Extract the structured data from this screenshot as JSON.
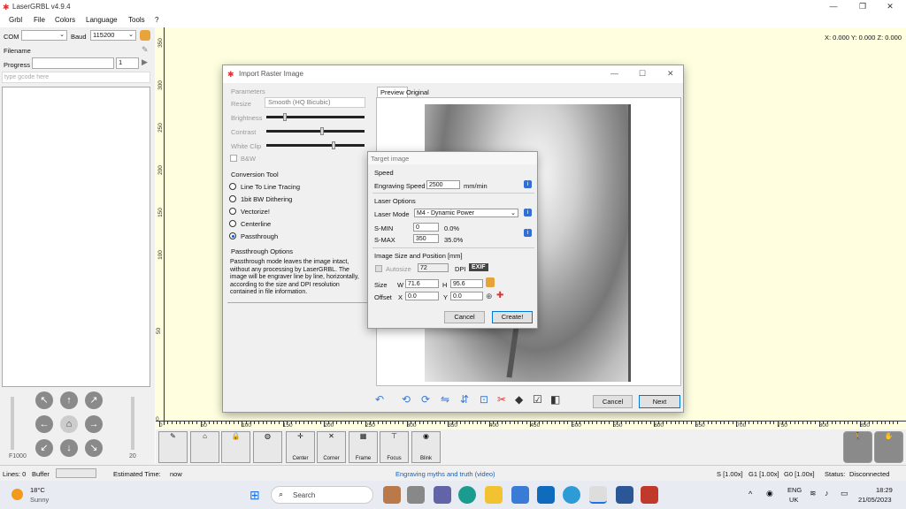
{
  "window": {
    "title": "LaserGRBL v4.9.4"
  },
  "menu": [
    "Grbl",
    "File",
    "Colors",
    "Language",
    "Tools",
    "?"
  ],
  "left": {
    "com_label": "COM",
    "com_value": "",
    "baud_label": "Baud",
    "baud_value": "115200",
    "filename_label": "Filename",
    "progress_label": "Progress",
    "progress_value": "1",
    "gcode_placeholder": "type gcode here",
    "feed": "F1000",
    "step": "20"
  },
  "coords": "X: 0.000 Y: 0.000 Z: 0.000",
  "vruler": [
    "350",
    "300",
    "250",
    "200",
    "150",
    "100",
    "50",
    "0"
  ],
  "hruler": [
    "0",
    "50",
    "100",
    "150",
    "200",
    "250",
    "300",
    "350",
    "400",
    "450",
    "500",
    "550",
    "600",
    "650",
    "700",
    "750",
    "800",
    "850"
  ],
  "toolbar": [
    "Center",
    "Corner",
    "Frame",
    "Focus",
    "Blink"
  ],
  "status": {
    "lines": "Lines: 0",
    "buffer": "Buffer",
    "est": "Estimated Time:",
    "est_val": "now",
    "link": "Engraving myths and truth (video)",
    "s": "S [1.00x]",
    "g1": "G1 [1.00x]",
    "g0": "G0 [1.00x]",
    "status": "Status:",
    "status_val": "Disconnected"
  },
  "dialog": {
    "title": "Import Raster Image",
    "params_label": "Parameters",
    "resize_label": "Resize",
    "resize_value": "Smooth (HQ Bicubic)",
    "brightness": "Brightness",
    "contrast": "Contrast",
    "whiteclip": "White Clip",
    "bw": "B&W",
    "conv_label": "Conversion Tool",
    "tools": [
      "Line To Line Tracing",
      "1bit BW Dithering",
      "Vectorize!",
      "Centerline",
      "Passthrough"
    ],
    "selected_tool": "Passthrough",
    "pt_label": "Passthrough Options",
    "pt_text": "Passthrough mode leaves the image intact, without any processing by LaserGRBL. The image will be engraver line by line, horizontally, according to the size and DPI resolution contained in file information.",
    "tab_preview": "Preview",
    "tab_original": "Original",
    "cancel": "Cancel",
    "next": "Next"
  },
  "target": {
    "title": "Target image",
    "speed_label": "Speed",
    "eng_speed_label": "Engraving Speed",
    "eng_speed": "2500",
    "unit": "mm/min",
    "laser_label": "Laser Options",
    "mode_label": "Laser Mode",
    "mode_value": "M4 - Dynamic Power",
    "smin_label": "S-MIN",
    "smin": "0",
    "smin_pct": "0.0%",
    "smax_label": "S-MAX",
    "smax": "350",
    "smax_pct": "35.0%",
    "size_label": "Image Size and Position [mm]",
    "autosize": "Autosize",
    "dpi": "72",
    "dpi_label": "DPI",
    "exif": "EXIF",
    "size": "Size",
    "w_label": "W",
    "w": "71.6",
    "h_label": "H",
    "h": "95.6",
    "offset": "Offset",
    "x_label": "X",
    "x": "0.0",
    "y_label": "Y",
    "y": "0.0",
    "cancel": "Cancel",
    "create": "Create!"
  },
  "taskbar": {
    "temp": "18°C",
    "weather": "Sunny",
    "search": "Search",
    "lang1": "ENG",
    "lang2": "UK",
    "time": "18:29",
    "date": "21/05/2023"
  },
  "progress": 0
}
